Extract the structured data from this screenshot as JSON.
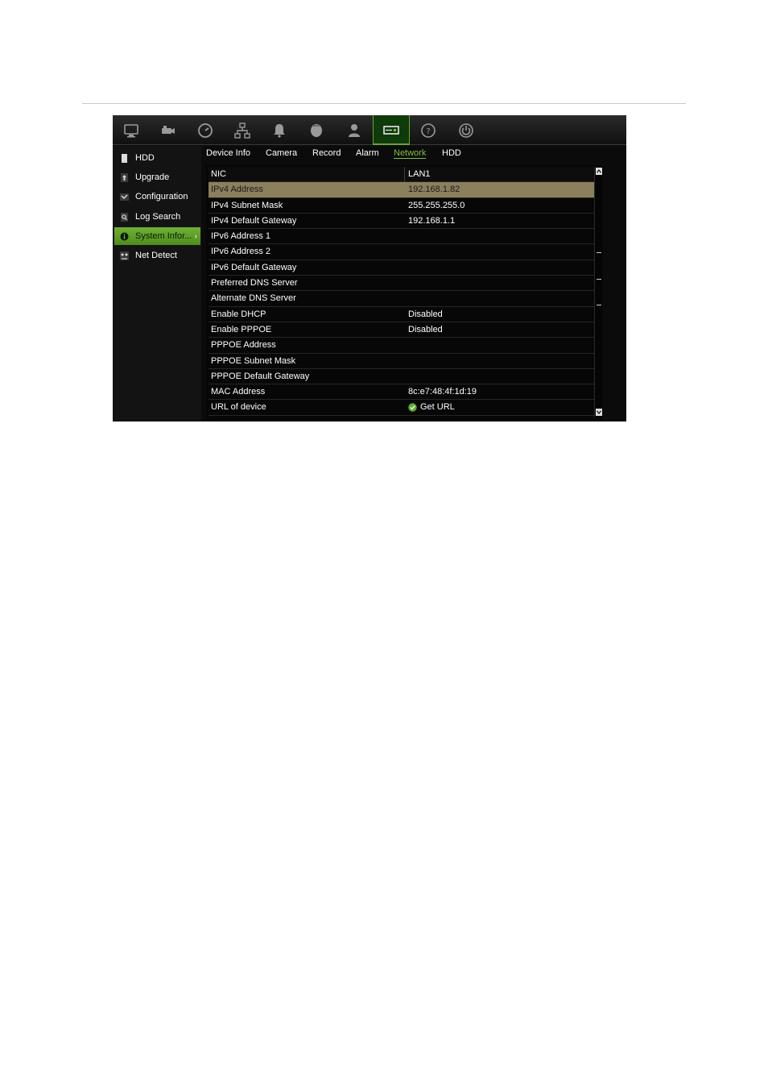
{
  "top_icons": [
    {
      "name": "monitor-icon"
    },
    {
      "name": "camera-icon"
    },
    {
      "name": "clock-icon"
    },
    {
      "name": "network-icon"
    },
    {
      "name": "bell-icon"
    },
    {
      "name": "dome-camera-icon"
    },
    {
      "name": "user-icon"
    },
    {
      "name": "device-management-icon",
      "active": true
    },
    {
      "name": "help-icon"
    },
    {
      "name": "power-icon"
    }
  ],
  "sidebar": {
    "items": [
      {
        "label": "HDD",
        "icon": "hdd-icon"
      },
      {
        "label": "Upgrade",
        "icon": "upgrade-icon"
      },
      {
        "label": "Configuration",
        "icon": "configuration-icon"
      },
      {
        "label": "Log Search",
        "icon": "log-search-icon"
      },
      {
        "label": "System Infor...",
        "icon": "info-icon",
        "active": true
      },
      {
        "label": "Net Detect",
        "icon": "net-detect-icon"
      }
    ]
  },
  "tabs": [
    {
      "label": "Device Info"
    },
    {
      "label": "Camera"
    },
    {
      "label": "Record"
    },
    {
      "label": "Alarm"
    },
    {
      "label": "Network",
      "active": true
    },
    {
      "label": "HDD"
    }
  ],
  "table": {
    "header": [
      "NIC",
      "LAN1"
    ],
    "rows": [
      [
        "IPv4 Address",
        "192.168.1.82"
      ],
      [
        "IPv4 Subnet Mask",
        "255.255.255.0"
      ],
      [
        "IPv4 Default Gateway",
        "192.168.1.1"
      ],
      [
        "IPv6 Address 1",
        ""
      ],
      [
        "IPv6 Address 2",
        ""
      ],
      [
        "IPv6 Default Gateway",
        ""
      ],
      [
        "Preferred DNS Server",
        ""
      ],
      [
        "Alternate DNS Server",
        ""
      ],
      [
        "Enable DHCP",
        "Disabled"
      ],
      [
        "Enable PPPOE",
        "Disabled"
      ],
      [
        "PPPOE Address",
        ""
      ],
      [
        "PPPOE Subnet Mask",
        ""
      ],
      [
        "PPPOE Default Gateway",
        ""
      ],
      [
        "MAC Address",
        "8c:e7:48:4f:1d:19"
      ],
      [
        "URL of device",
        "Get URL"
      ]
    ],
    "selected_row": "IPv4 Address"
  },
  "colors": {
    "accent_green": "#7ec23a",
    "selected_row": "#8b7f5d",
    "background": "#0b0b0b"
  }
}
